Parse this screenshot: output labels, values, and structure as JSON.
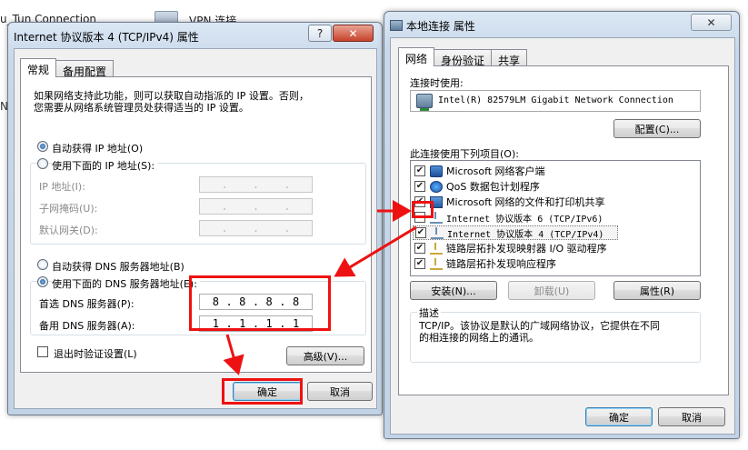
{
  "background": {
    "item1": "u_Tun Connection",
    "item2": "VPN 连接",
    "edge_char": "N"
  },
  "left_window": {
    "title": "Internet 协议版本 4 (TCP/IPv4) 属性",
    "help_button": "?",
    "close_button": "✕",
    "tabs": [
      "常规",
      "备用配置"
    ],
    "description": "如果网络支持此功能，则可以获取自动指派的 IP 设置。否则，\n您需要从网络系统管理员处获得适当的 IP 设置。",
    "auto_ip": "自动获得 IP 地址(O)",
    "manual_ip": "使用下面的 IP 地址(S):",
    "ip_label": "IP 地址(I):",
    "subnet_label": "子网掩码(U):",
    "gateway_label": "默认网关(D):",
    "auto_dns": "自动获得 DNS 服务器地址(B)",
    "manual_dns": "使用下面的 DNS 服务器地址(E):",
    "preferred_dns_label": "首选 DNS 服务器(P):",
    "alternate_dns_label": "备用 DNS 服务器(A):",
    "preferred_dns": [
      "8",
      "8",
      "8",
      "8"
    ],
    "alternate_dns": [
      "1",
      "1",
      "1",
      "1"
    ],
    "validate_on_exit": "退出时验证设置(L)",
    "advanced_button": "高级(V)...",
    "ok_button": "确定",
    "cancel_button": "取消"
  },
  "right_window": {
    "title": "本地连接 属性",
    "close_button": "✕",
    "tabs": [
      "网络",
      "身份验证",
      "共享"
    ],
    "connect_using_label": "连接时使用:",
    "adapter_name": "Intel(R) 82579LM Gigabit Network Connection",
    "configure_button": "配置(C)...",
    "items_label": "此连接使用下列项目(O):",
    "items": [
      {
        "label": "Microsoft 网络客户端",
        "checked": true,
        "icon": "network-client-icon"
      },
      {
        "label": "QoS 数据包计划程序",
        "checked": true,
        "icon": "qos-icon"
      },
      {
        "label": "Microsoft 网络的文件和打印机共享",
        "checked": true,
        "icon": "file-share-icon"
      },
      {
        "label": "Internet 协议版本 6 (TCP/IPv6)",
        "checked": false,
        "icon": "protocol-icon"
      },
      {
        "label": "Internet 协议版本 4 (TCP/IPv4)",
        "checked": true,
        "icon": "protocol-icon"
      },
      {
        "label": "链路层拓扑发现映射器 I/O 驱动程序",
        "checked": true,
        "icon": "link-layer-icon"
      },
      {
        "label": "链路层拓扑发现响应程序",
        "checked": true,
        "icon": "link-layer-icon"
      }
    ],
    "install_button": "安装(N)...",
    "uninstall_button": "卸载(U)",
    "properties_button": "属性(R)",
    "description_group": "描述",
    "description_text": "TCP/IP。该协议是默认的广域网络协议，它提供在不同\n的相连接的网络上的通讯。",
    "ok_button": "确定",
    "cancel_button": "取消"
  },
  "colors": {
    "annotation_red": "#ee1111",
    "window_frame": "#c3d3e6",
    "client_bg": "#f0f0f0"
  }
}
